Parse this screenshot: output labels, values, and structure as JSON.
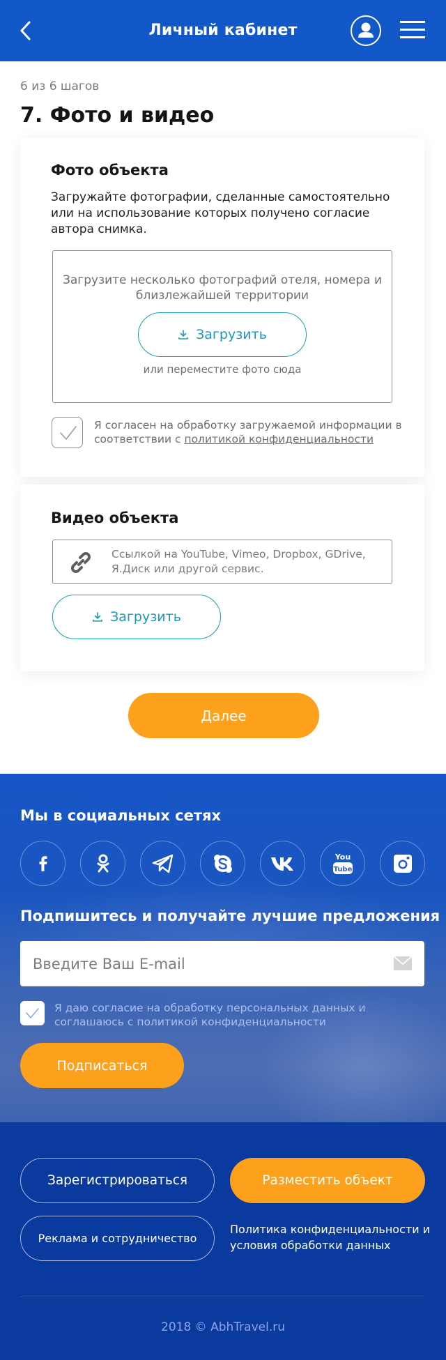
{
  "header": {
    "title": "Личный кабинет",
    "back_icon": "chevron-left-icon",
    "user_icon": "user-icon",
    "menu_icon": "hamburger-menu-icon"
  },
  "progress": {
    "steps_text": "6 из 6 шагов"
  },
  "page_title": "7. Фото и видео",
  "photo_section": {
    "title": "Фото объекта",
    "description": "Загружайте фотографии, сделанные самостоятельно или на использование которых получено согласие автора снимка.",
    "dropzone_text": "Загрузите несколько фотографий отеля, номера и близлежайшей территории",
    "upload_label": "Загрузить",
    "dropzone_hint": "или переместите фото сюда",
    "agree_text": "Я согласен на обработку загружаемой информации в соответствии с",
    "agree_link": "политикой конфиденциальности",
    "agree_checked": true
  },
  "video_section": {
    "title": "Видео объекта",
    "placeholder": "Ссылкой на YouTube, Vimeo, Dropbox, GDrive, Я.Диск или другой сервис.",
    "upload_label": "Загрузить"
  },
  "next_button": "Далее",
  "social": {
    "title": "Мы в социальных сетях",
    "networks": [
      "facebook-icon",
      "odnoklassniki-icon",
      "telegram-icon",
      "skype-icon",
      "vk-icon",
      "youtube-icon",
      "instagram-icon"
    ]
  },
  "subscribe": {
    "title": "Подпишитесь и получайте лучшие предложения",
    "email_placeholder": "Введите Ваш E-mail",
    "agree_text": "Я даю согласие на обработку персональных данных и соглашаюсь с политикой конфиденциальности",
    "agree_checked": true,
    "button": "Подписаться"
  },
  "footer": {
    "register": "Зарегистрироваться",
    "place_object": "Разместить объект",
    "advertising": "Реклама и сотрудничество",
    "policy": "Политика конфиденциальности и условия обработки данных",
    "copyright": "2018 © AbhTravel.ru"
  },
  "colors": {
    "primary_blue": "#1358c8",
    "footer_blue": "#0b3a9e",
    "accent_orange": "#fda01c",
    "teal": "#1a9ab3"
  }
}
